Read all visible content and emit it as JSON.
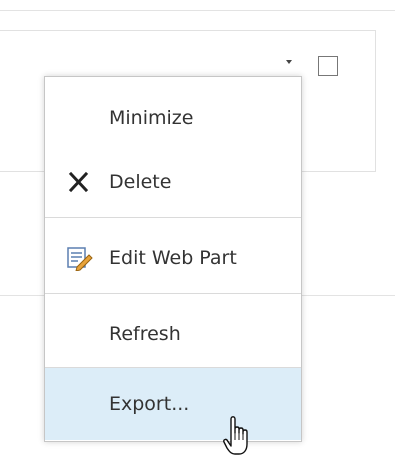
{
  "context_menu": {
    "items": [
      {
        "label": "Minimize",
        "icon": ""
      },
      {
        "label": "Delete",
        "icon": "close-x-icon"
      },
      {
        "label": "Edit Web Part",
        "icon": "edit-document-icon"
      },
      {
        "label": "Refresh",
        "icon": ""
      },
      {
        "label": "Export...",
        "icon": "",
        "state": "hovered"
      }
    ]
  },
  "colors": {
    "hover_background": "#dcedf8",
    "menu_border": "#c6c6c6",
    "text": "#333333"
  }
}
